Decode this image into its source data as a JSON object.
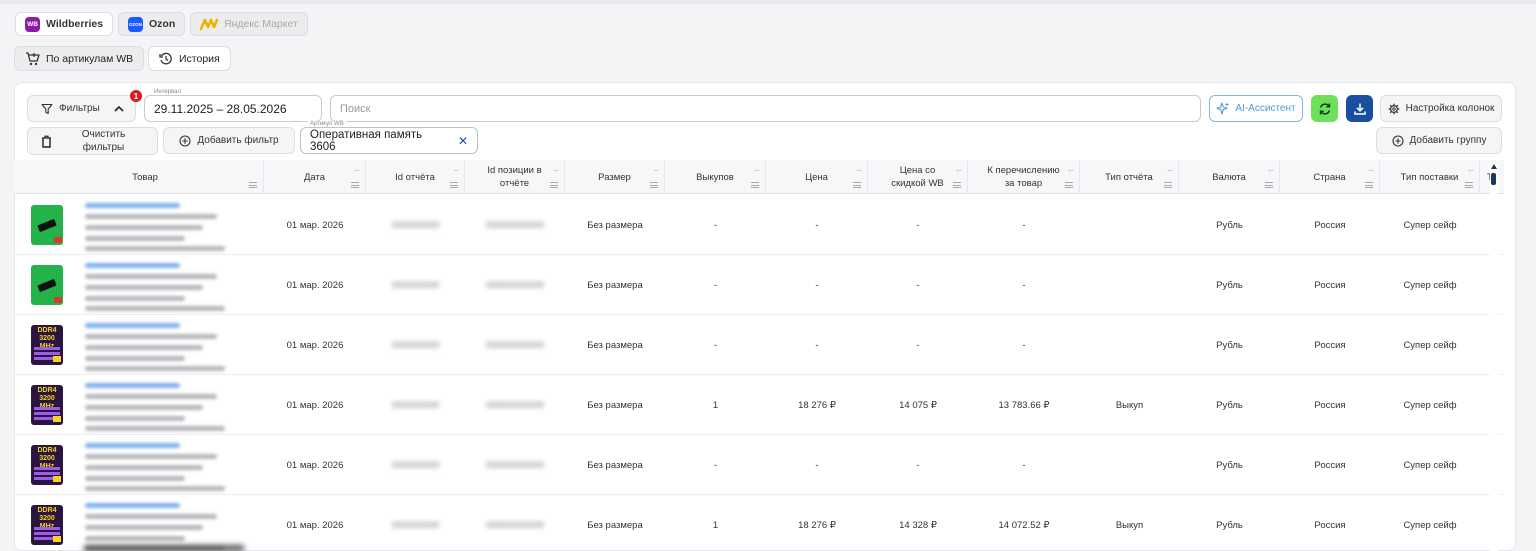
{
  "marketplaces": [
    {
      "label": "Wildberries",
      "logo": "WB",
      "color": "#8e1aa6"
    },
    {
      "label": "Ozon",
      "logo": "OZON",
      "color": "#1a5bff"
    },
    {
      "label": "Яндекс Маркет",
      "logo": "",
      "color": "#f5c518"
    }
  ],
  "view_tabs": {
    "by_articles": "По артикулам WB",
    "history": "История"
  },
  "toolbar": {
    "filters_label": "Фильтры",
    "filters_badge": "1",
    "interval_label": "Интервал",
    "interval_value": "29.11.2025 – 28.05.2026",
    "search_placeholder": "Поиск",
    "ai_label": "AI-Ассистент",
    "columns_label": "Настройка колонок",
    "clear_filters_label": "Очистить фильтры",
    "add_filter_label": "Добавить фильтр",
    "chip_label": "Артикул WB",
    "chip_value": "Оперативная память 3606",
    "add_group_label": "Добавить группу"
  },
  "table": {
    "columns": [
      "Товар",
      "Дата",
      "Id отчёта",
      "Id позиции в отчёте",
      "Размер",
      "Выкупов",
      "Цена",
      "Цена со скидкой WB",
      "К перечислению за товар",
      "Тип отчёта",
      "Валюта",
      "Страна",
      "Тип поставки",
      "Ти"
    ],
    "rows": [
      {
        "date": "01 мар. 2026",
        "report_id": "000000000",
        "position_id": "00000000000",
        "size": "Без размера",
        "buyouts": "-",
        "price": "-",
        "discount_price": "-",
        "payout": "-",
        "report_type": "",
        "currency": "Рубль",
        "country": "Россия",
        "supply": "Супер сейф"
      },
      {
        "date": "01 мар. 2026",
        "report_id": "000000000",
        "position_id": "00000000000",
        "size": "Без размера",
        "buyouts": "-",
        "price": "-",
        "discount_price": "-",
        "payout": "-",
        "report_type": "",
        "currency": "Рубль",
        "country": "Россия",
        "supply": "Супер сейф"
      },
      {
        "date": "01 мар. 2026",
        "report_id": "000000000",
        "position_id": "00000000000",
        "size": "Без размера",
        "buyouts": "-",
        "price": "-",
        "discount_price": "-",
        "payout": "-",
        "report_type": "",
        "currency": "Рубль",
        "country": "Россия",
        "supply": "Супер сейф"
      },
      {
        "date": "01 мар. 2026",
        "report_id": "000000000",
        "position_id": "00000000000",
        "size": "Без размера",
        "buyouts": "1",
        "price": "18 276 ₽",
        "discount_price": "14 075 ₽",
        "payout": "13 783.66 ₽",
        "report_type": "Выкуп",
        "currency": "Рубль",
        "country": "Россия",
        "supply": "Супер сейф"
      },
      {
        "date": "01 мар. 2026",
        "report_id": "000000000",
        "position_id": "00000000000",
        "size": "Без размера",
        "buyouts": "-",
        "price": "-",
        "discount_price": "-",
        "payout": "-",
        "report_type": "",
        "currency": "Рубль",
        "country": "Россия",
        "supply": "Супер сейф"
      },
      {
        "date": "01 мар. 2026",
        "report_id": "000000000",
        "position_id": "00000000000",
        "size": "Без размера",
        "buyouts": "1",
        "price": "18 276 ₽",
        "discount_price": "14 328 ₽",
        "payout": "14 072.52 ₽",
        "report_type": "Выкуп",
        "currency": "Рубль",
        "country": "Россия",
        "supply": "Супер сейф"
      }
    ]
  },
  "thumbnails": [
    {
      "style": "green",
      "caption": ""
    },
    {
      "style": "green",
      "caption": ""
    },
    {
      "style": "dark",
      "caption": "DDR4 3200 MHz"
    },
    {
      "style": "dark",
      "caption": "DDR4 3200 MHz"
    },
    {
      "style": "dark",
      "caption": "DDR4 3200 MHz"
    },
    {
      "style": "dark",
      "caption": "DDR4 3200 MHz"
    }
  ],
  "colors": {
    "accent": "#1a4fa0",
    "green": "#6fe05a",
    "badge": "#d91c1c",
    "ai": "#4a9ad8"
  }
}
